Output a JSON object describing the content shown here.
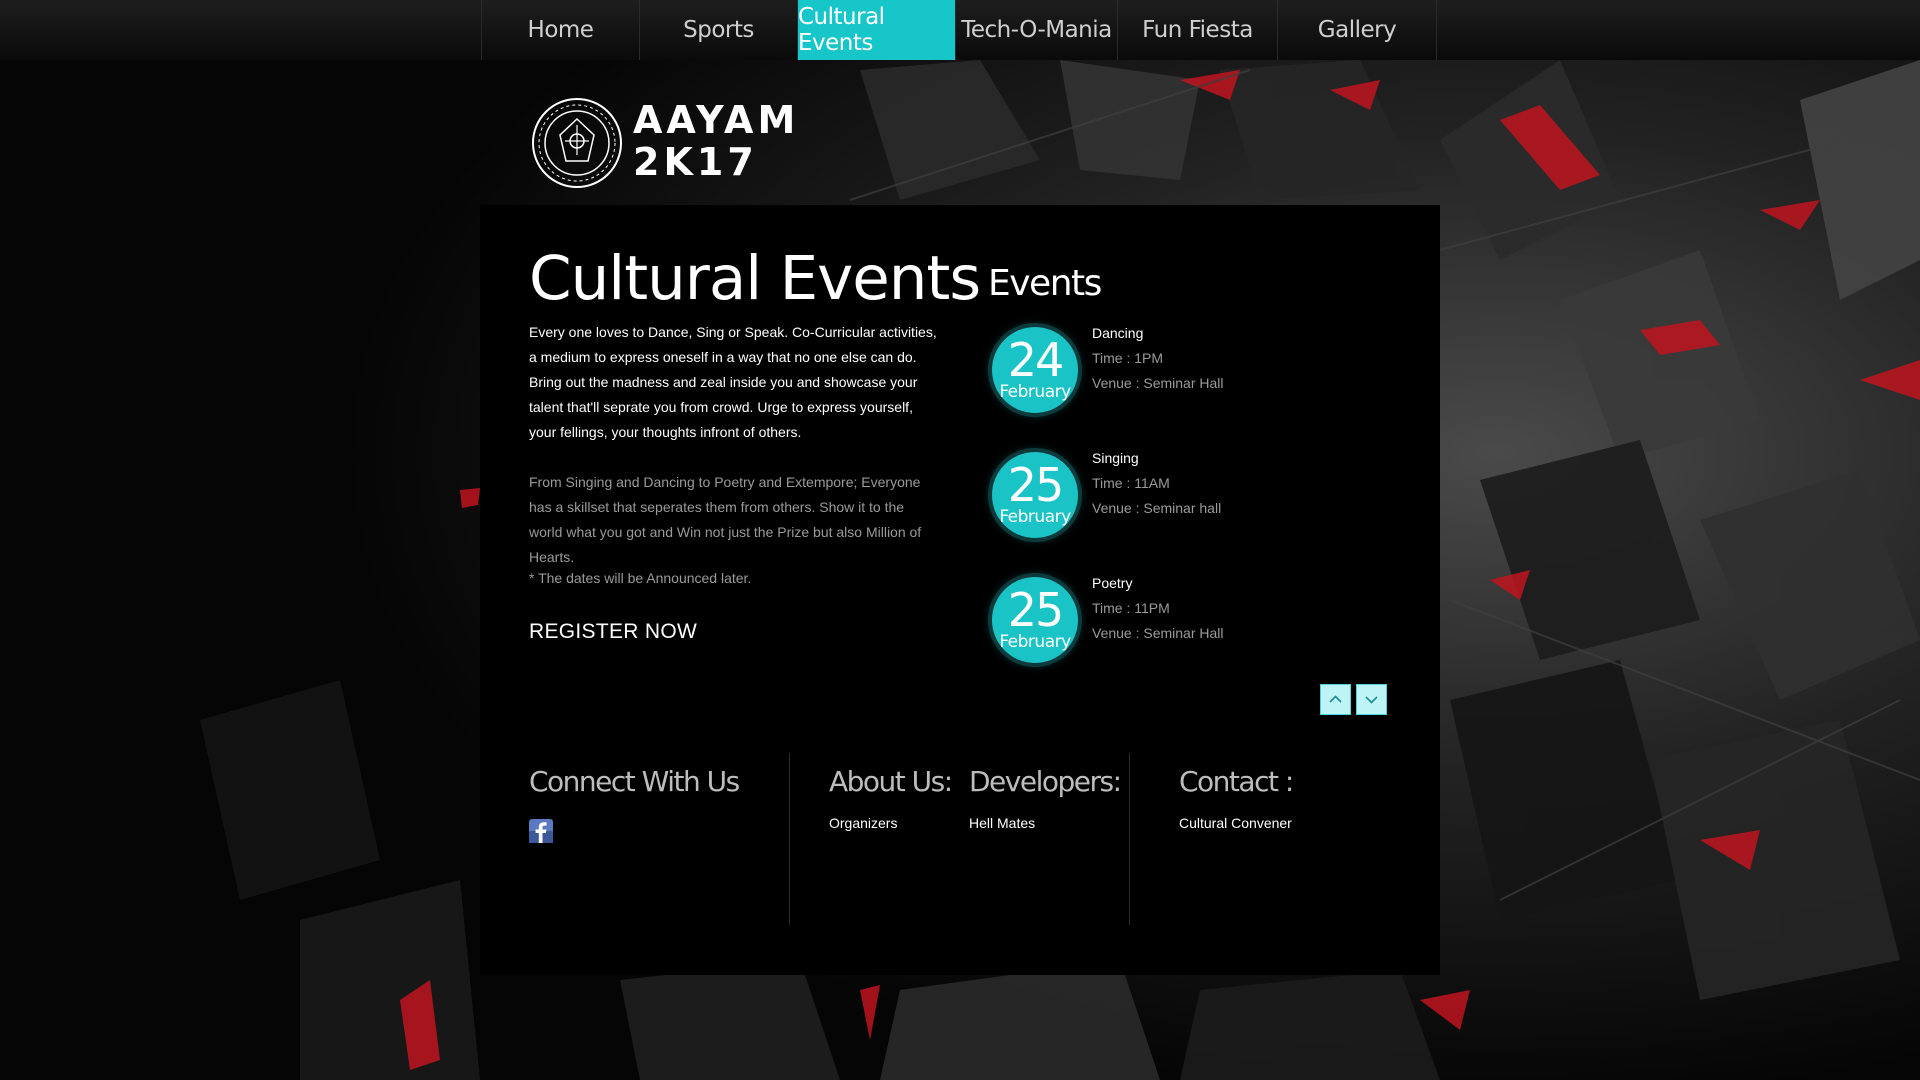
{
  "nav": {
    "items": [
      {
        "label": "Home"
      },
      {
        "label": "Sports"
      },
      {
        "label": "Cultural Events",
        "active": true
      },
      {
        "label": "Tech-O-Mania"
      },
      {
        "label": "Fun Fiesta"
      },
      {
        "label": "Gallery"
      }
    ]
  },
  "logo": {
    "emblem": "college-emblem-icon",
    "line1": "AAYAM",
    "line2": "2K17"
  },
  "main": {
    "title": "Cultural Events",
    "intro": "Every one loves to Dance, Sing or Speak. Co-Curricular activities, a medium to express oneself in a way that no one else can do. Bring out the madness and zeal inside you and showcase your talent that'll seprate you from crowd. Urge to express yourself, your fellings, your thoughts infront of others.",
    "intro2": "From Singing and Dancing to Poetry and Extempore; Everyone has a skillset that seperates them from others. Show it to the world what you got and Win not just the Prize but also Million of Hearts.",
    "note": "* The dates will be Announced later.",
    "register": "REGISTER NOW"
  },
  "events": {
    "title": "Events",
    "items": [
      {
        "day": "24",
        "month": "February",
        "name": "Dancing",
        "time": "Time : 1PM",
        "venue": "Venue : Seminar Hall"
      },
      {
        "day": "25",
        "month": "February",
        "name": "Singing",
        "time": "Time : 11AM",
        "venue": "Venue : Seminar hall"
      },
      {
        "day": "25",
        "month": "February",
        "name": "Poetry",
        "time": "Time : 11PM",
        "venue": "Venue : Seminar Hall"
      }
    ],
    "up_icon": "chevron-up-icon",
    "down_icon": "chevron-down-icon"
  },
  "footer": {
    "connect": {
      "heading": "Connect With Us",
      "icon": "facebook-icon"
    },
    "about": {
      "heading": "About Us:",
      "link": "Organizers"
    },
    "developers": {
      "heading": "Developers:",
      "link": "Hell Mates"
    },
    "contact": {
      "heading": "Contact :",
      "link": "Cultural Convener"
    }
  },
  "colors": {
    "accent": "#16c6c9",
    "background": "#000000",
    "muted_text": "#9a9a9a"
  }
}
